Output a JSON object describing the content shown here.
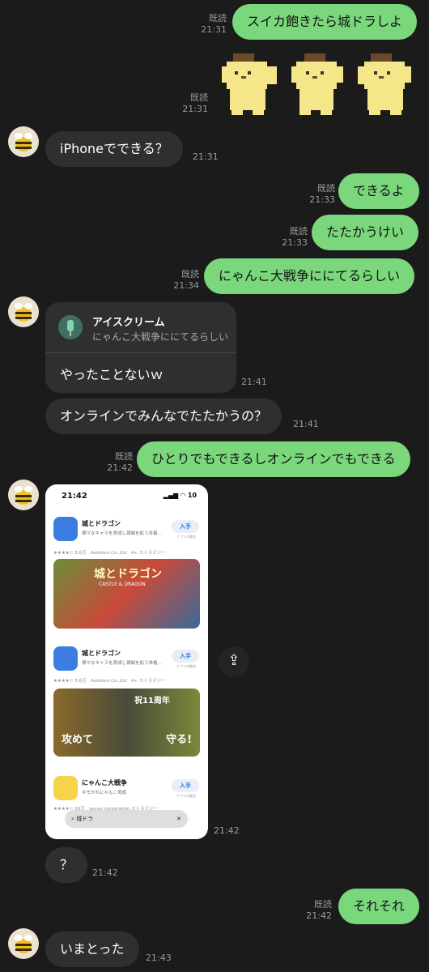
{
  "colors": {
    "background": "#1b1b1b",
    "outgoing_bubble": "#7ad77c",
    "incoming_bubble": "#2f2f2f",
    "meta_text": "#9a9a9a"
  },
  "messages": {
    "m1": {
      "text": "スイカ飽きたら城ドラしよ",
      "read": "既読",
      "time": "21:31"
    },
    "m2": {
      "read": "既読",
      "time": "21:31"
    },
    "m3": {
      "text": "iPhoneでできる？",
      "time": "21:31"
    },
    "m4": {
      "text": "できるよ",
      "read": "既読",
      "time": "21:33"
    },
    "m5": {
      "text": "たたかうけい",
      "read": "既読",
      "time": "21:33"
    },
    "m6": {
      "text": "にゃんこ大戦争ににてるらしい",
      "read": "既読",
      "time": "21:34"
    },
    "m7": {
      "reply_name": "アイスクリーム",
      "reply_quote": "にゃんこ大戦争ににてるらしい",
      "text": "やったことないｗ",
      "time": "21:41"
    },
    "m8": {
      "text": "オンラインでみんなでたたかうの？",
      "time": "21:41"
    },
    "m9": {
      "text": "ひとりでもできるしオンラインでもできる",
      "read": "既読",
      "time": "21:42"
    },
    "m10": {
      "time": "21:42"
    },
    "m11": {
      "text": "？",
      "time": "21:42"
    },
    "m12": {
      "text": "それそれ",
      "read": "既読",
      "time": "21:42"
    },
    "m13": {
      "text": "いまとった",
      "time": "21:43"
    }
  },
  "screenshot": {
    "status_time": "21:42",
    "battery": "10",
    "apps": [
      {
        "name": "城とドラゴン",
        "desc": "様々なキャラを育成し領城を拡う本格…",
        "get": "入手",
        "get_sub": "アプリ内課金",
        "stats": "★★★★☆ 5.6万",
        "dev": "Asobism.Co.,Ltd",
        "age": "4+",
        "genre": "ストラテジー"
      },
      {
        "name": "城とドラゴン",
        "desc": "様々なキャラを育成し領城を拡う本格…",
        "get": "入手",
        "get_sub": "アプリ内課金",
        "stats": "★★★★☆ 5.6万",
        "dev": "Asobism.Co.,Ltd",
        "age": "4+",
        "genre": "ストラテジー"
      },
      {
        "name": "にゃんこ大戦争",
        "desc": "キモかわにゃんこ育成",
        "get": "入手",
        "get_sub": "アプリ内課金",
        "stats": "★★★★☆ 20万",
        "dev": "ponos corporation",
        "age": "",
        "genre": "ストラテジー"
      }
    ],
    "banner1_title": "城とドラゴン",
    "banner1_sub": "CASTLE & DRAGON",
    "banner2_left": "攻めて",
    "banner2_right": "守る!",
    "banner2_badge": "祝11周年",
    "search_text": "城ドラ"
  }
}
